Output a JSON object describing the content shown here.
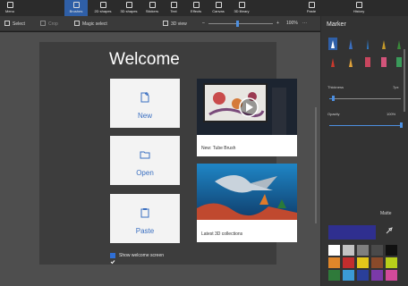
{
  "ribbon": {
    "tabs": [
      {
        "label": "Menu",
        "icon": "menu-icon"
      },
      {
        "label": "Brushes",
        "icon": "brush-icon"
      },
      {
        "label": "2D shapes",
        "icon": "shapes-2d-icon"
      },
      {
        "label": "3D shapes",
        "icon": "shapes-3d-icon"
      },
      {
        "label": "Stickers",
        "icon": "sticker-icon"
      },
      {
        "label": "Text",
        "icon": "text-icon"
      },
      {
        "label": "Effects",
        "icon": "effects-icon"
      },
      {
        "label": "Canvas",
        "icon": "canvas-icon"
      },
      {
        "label": "3D library",
        "icon": "library-icon"
      },
      {
        "label": "Paste",
        "icon": "paste-icon"
      },
      {
        "label": "History",
        "icon": "history-icon"
      }
    ],
    "active_tab": "Brushes",
    "accent_color": "#2f5fa7"
  },
  "toolbar": {
    "select_label": "Select",
    "crop_label": "Crop",
    "magic_select_label": "Magic select",
    "view_label": "3D view",
    "zoom_percent": "100%",
    "zoom_level_fraction": 0.45
  },
  "welcome": {
    "title": "Welcome",
    "new_label": "New",
    "open_label": "Open",
    "paste_label": "Paste",
    "card1_caption": "New: Tube Brush",
    "card2_caption": "Latest 3D collections",
    "show_welcome_label": "Show welcome screen",
    "show_welcome_checked": true
  },
  "panel": {
    "title": "Marker",
    "thickness_label": "Thickness",
    "thickness_value": "7px",
    "opacity_label": "Opacity",
    "opacity_value": "100%",
    "thickness_fraction": 0.05,
    "opacity_fraction": 1.0,
    "palette_label": "Matte",
    "current_color": "#2f2f8f"
  }
}
